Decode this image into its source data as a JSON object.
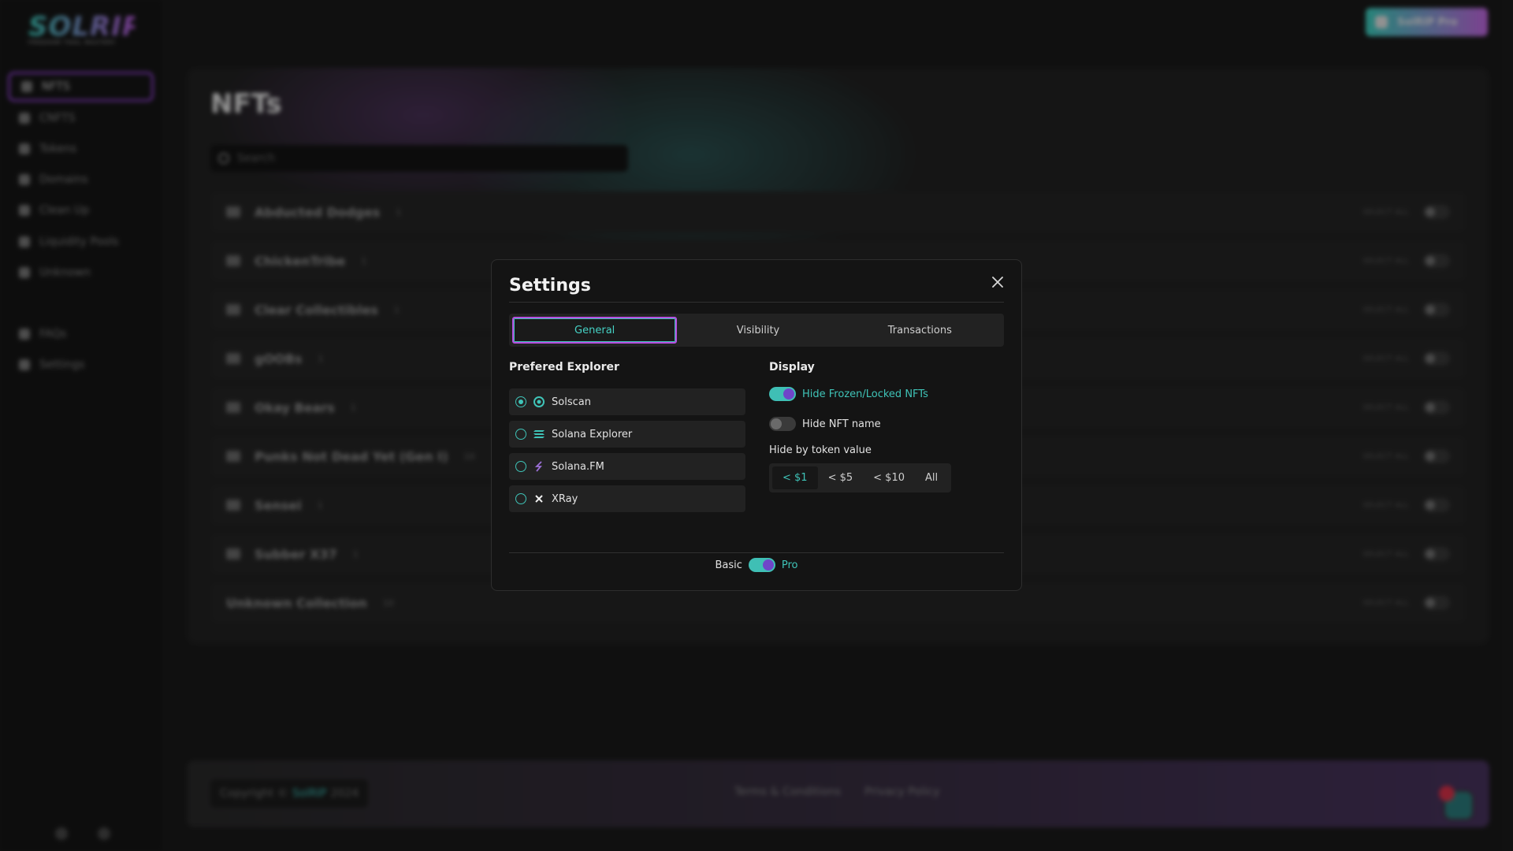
{
  "app": {
    "logo_text": "SOLRIP",
    "logo_tagline": "FREEDOM TOOL MASTERY",
    "top_button_label": "SolRIP Pro"
  },
  "sidebar": {
    "items": [
      {
        "label": "NFTS",
        "icon": "image-icon",
        "active": true
      },
      {
        "label": "CNFTS",
        "icon": "compressed-icon"
      },
      {
        "label": "Tokens",
        "icon": "token-icon"
      },
      {
        "label": "Domains",
        "icon": "globe-icon"
      },
      {
        "label": "Clean Up",
        "icon": "broom-icon"
      },
      {
        "label": "Liquidity Pools",
        "icon": "pool-icon"
      },
      {
        "label": "Unknown",
        "icon": "question-icon"
      }
    ],
    "secondary": [
      {
        "label": "FAQs",
        "icon": "document-icon"
      },
      {
        "label": "Settings",
        "icon": "gear-icon"
      }
    ]
  },
  "main": {
    "title": "NFTs",
    "search_placeholder": "Search",
    "select_all_label": "SELECT ALL",
    "collections": [
      {
        "name": "Abducted Dodges",
        "count": "1"
      },
      {
        "name": "ChickenTribe",
        "count": "1"
      },
      {
        "name": "Clear Collectibles",
        "count": "1"
      },
      {
        "name": "gOOBs",
        "count": "1"
      },
      {
        "name": "Okay Bears",
        "count": "1"
      },
      {
        "name": "Punks Not Dead Yet (Gen I)",
        "count": "10"
      },
      {
        "name": "Sensei",
        "count": "1"
      },
      {
        "name": "Subber X37",
        "count": "1"
      },
      {
        "name": "Unknown Collection",
        "count": "10"
      }
    ]
  },
  "footer": {
    "copyright_prefix": "Copyright ©",
    "brand": "SolRIP",
    "year": "2024",
    "links": [
      "Terms & Conditions",
      "Privacy Policy"
    ]
  },
  "modal": {
    "title": "Settings",
    "tabs": [
      {
        "label": "General",
        "active": true
      },
      {
        "label": "Visibility",
        "active": false
      },
      {
        "label": "Transactions",
        "active": false
      }
    ],
    "explorer_heading": "Prefered Explorer",
    "explorers": [
      {
        "label": "Solscan",
        "icon": "solscan-icon",
        "selected": true
      },
      {
        "label": "Solana Explorer",
        "icon": "solana-icon",
        "selected": false
      },
      {
        "label": "Solana.FM",
        "icon": "solanafm-icon",
        "selected": false
      },
      {
        "label": "XRay",
        "icon": "xray-icon",
        "selected": false
      }
    ],
    "display_heading": "Display",
    "display_toggles": [
      {
        "label": "Hide Frozen/Locked NFTs",
        "on": true
      },
      {
        "label": "Hide NFT name",
        "on": false
      }
    ],
    "hide_value_label": "Hide by token value",
    "hide_value_options": [
      {
        "label": "< $1",
        "active": true
      },
      {
        "label": "< $5",
        "active": false
      },
      {
        "label": "< $10",
        "active": false
      },
      {
        "label": "All",
        "active": false
      }
    ],
    "mode": {
      "left": "Basic",
      "right": "Pro",
      "pro_on": true
    }
  },
  "colors": {
    "accent_teal": "#3fc4b8",
    "accent_purple": "#b64fe0",
    "knob_purple": "#6f45c9",
    "modal_bg": "#141414",
    "page_bg": "#1b1b1b"
  }
}
